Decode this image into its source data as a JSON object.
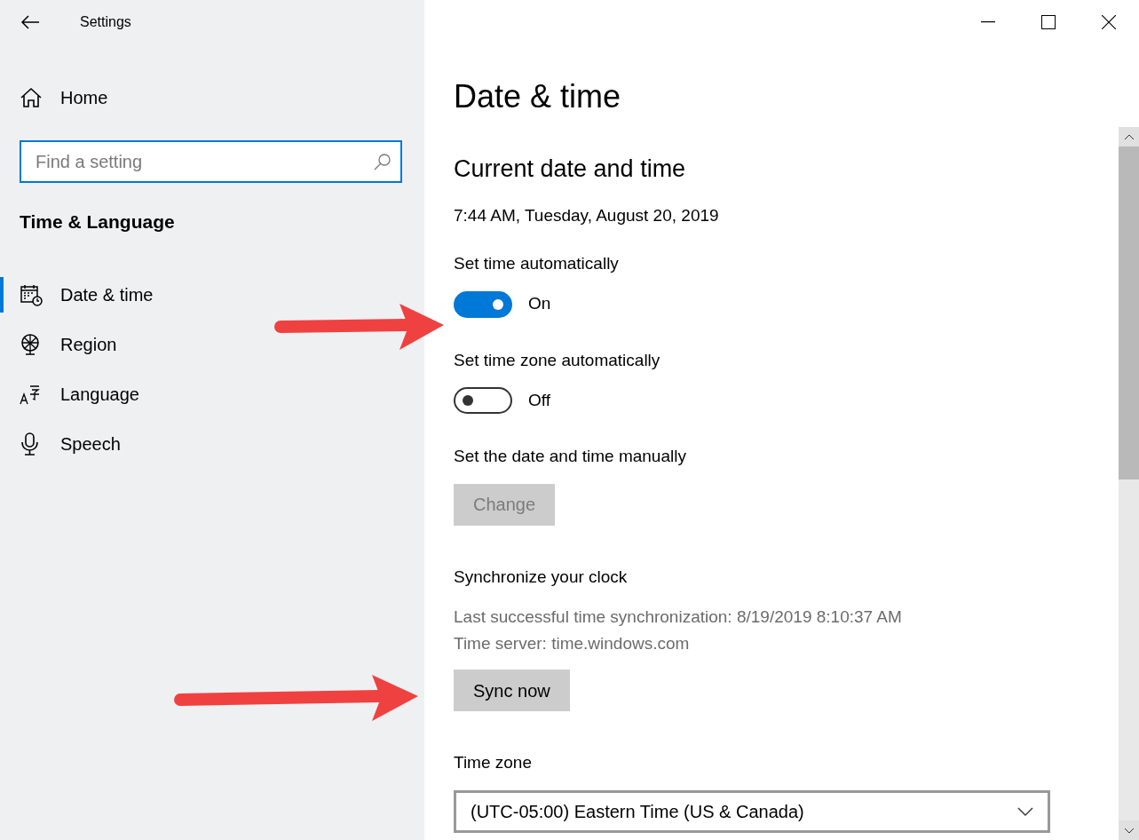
{
  "window": {
    "title": "Settings"
  },
  "sidebar": {
    "home": "Home",
    "search": {
      "placeholder": "Find a setting"
    },
    "section": "Time & Language",
    "items": [
      {
        "label": "Date & time",
        "selected": true
      },
      {
        "label": "Region",
        "selected": false
      },
      {
        "label": "Language",
        "selected": false
      },
      {
        "label": "Speech",
        "selected": false
      }
    ]
  },
  "page": {
    "title": "Date & time",
    "items": [
      {
        "kind": "subheading",
        "text": "Current date and time"
      },
      {
        "kind": "text",
        "text": "7:44 AM, Tuesday, August 20, 2019"
      },
      {
        "kind": "label",
        "text": "Set time automatically"
      },
      {
        "kind": "toggle",
        "on": true,
        "text": "On"
      },
      {
        "kind": "label",
        "text": "Set time zone automatically"
      },
      {
        "kind": "toggle",
        "on": false,
        "text": "Off"
      },
      {
        "kind": "label",
        "text": "Set the date and time manually"
      },
      {
        "kind": "button",
        "text": "Change",
        "disabled": true
      },
      {
        "kind": "label",
        "text": "Synchronize your clock"
      },
      {
        "kind": "note",
        "text": "Last successful time synchronization: 8/19/2019 8:10:37 AM"
      },
      {
        "kind": "note",
        "text": "Time server: time.windows.com"
      },
      {
        "kind": "button",
        "text": "Sync now",
        "disabled": false
      },
      {
        "kind": "label",
        "text": "Time zone"
      },
      {
        "kind": "select",
        "text": "(UTC-05:00) Eastern Time (US & Canada)"
      }
    ]
  }
}
